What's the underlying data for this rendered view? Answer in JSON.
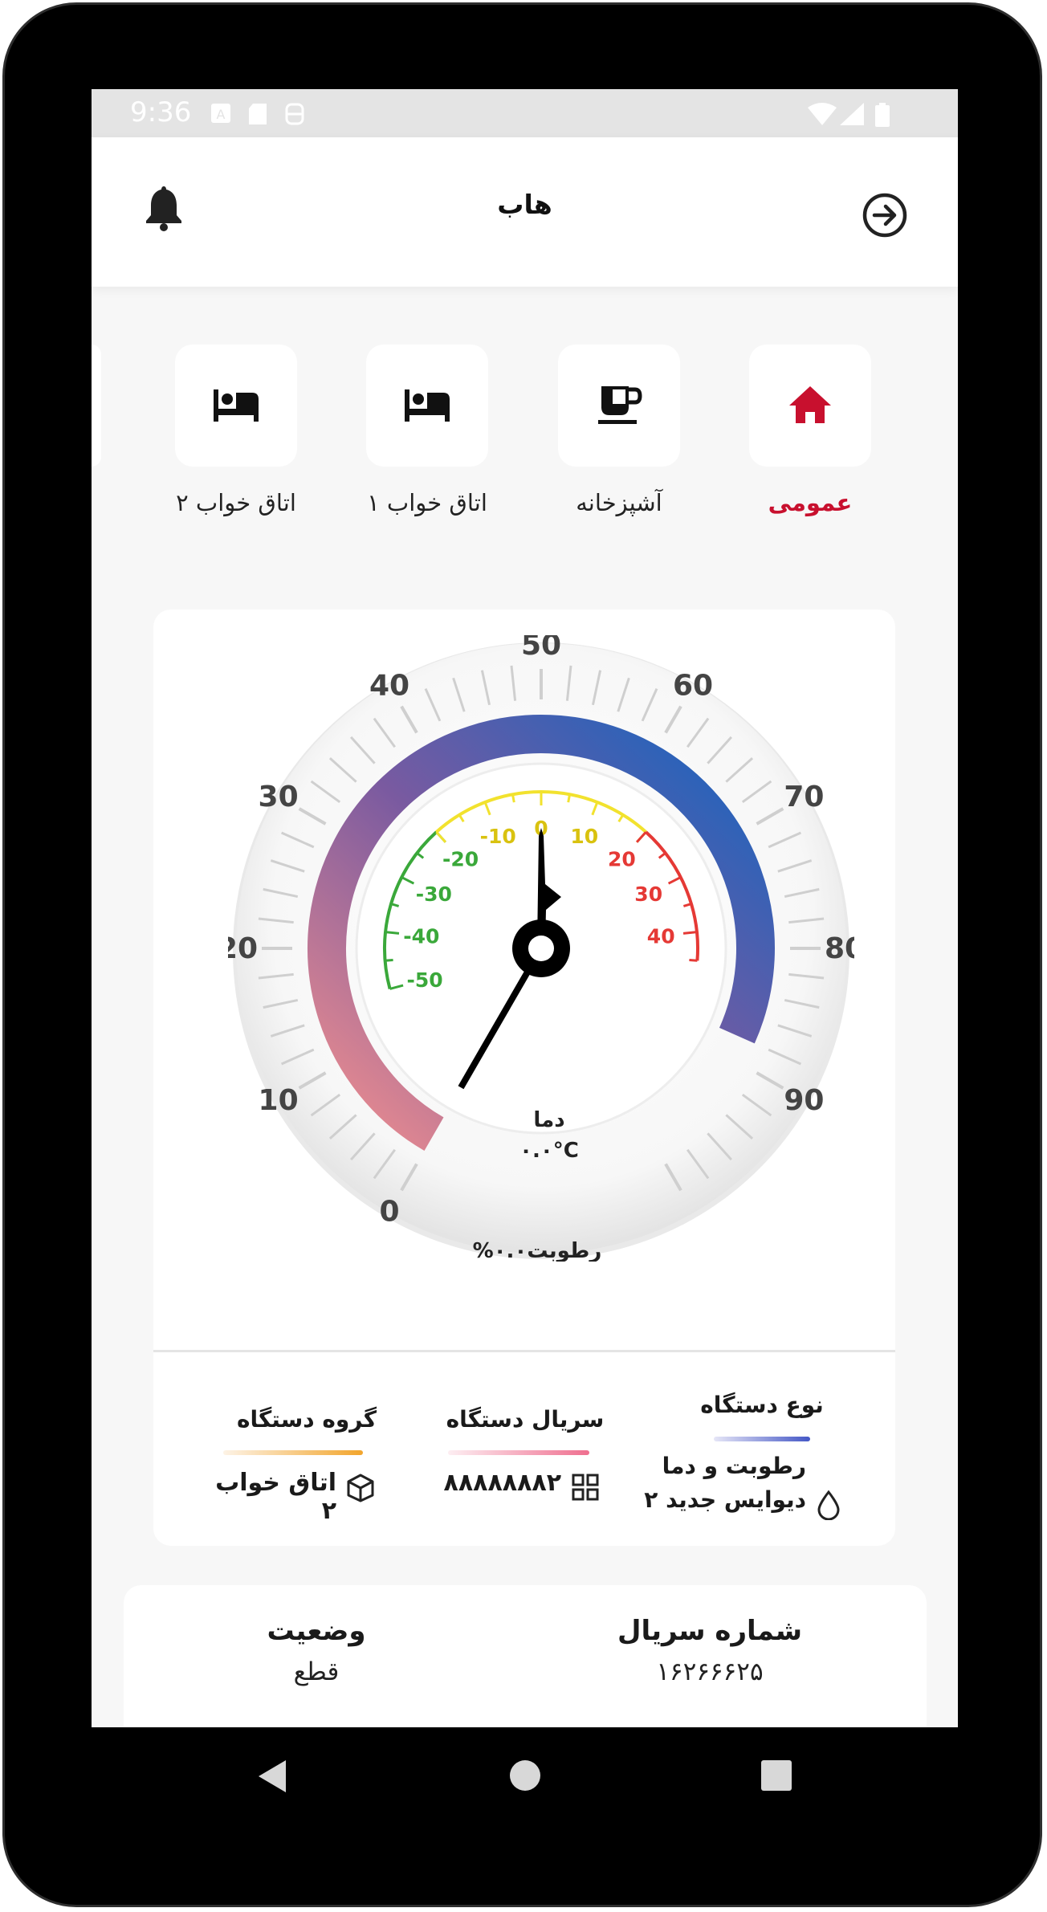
{
  "status_bar": {
    "time": "9:36"
  },
  "header": {
    "title": "هاب",
    "bell_icon": "bell-icon",
    "nav_icon": "arrow-right-circle-icon"
  },
  "categories": [
    {
      "label": "عمومی",
      "icon": "home-icon",
      "active": true
    },
    {
      "label": "آشپزخانه",
      "icon": "cup-icon",
      "active": false
    },
    {
      "label": "اتاق خواب ۱",
      "icon": "bed-icon",
      "active": false
    },
    {
      "label": "اتاق خواب ۲",
      "icon": "bed-icon",
      "active": false
    }
  ],
  "gauge": {
    "outer_ticks": [
      "0",
      "10",
      "20",
      "30",
      "40",
      "50",
      "60",
      "70",
      "80",
      "90"
    ],
    "inner_ticks": [
      "-50",
      "-40",
      "-30",
      "-20",
      "-10",
      "0",
      "10",
      "20",
      "30",
      "40"
    ],
    "temp_label": "دما",
    "temp_value": "۰.۰°C",
    "humidity_label": "%۰.۰رطوبت",
    "colors": {
      "humidity_low": "#f08e8e",
      "humidity_mid": "#7a5aa0",
      "humidity_high": "#1565c0",
      "temp_cold": "#3aa83a",
      "temp_mid": "#f2e22e",
      "temp_hot": "#e53935"
    }
  },
  "device_info": {
    "type": {
      "title": "نوع دستگاه",
      "line1": "رطوبت و دما",
      "line2": "دیوایس جدید ۲",
      "icon": "drop-icon"
    },
    "serial": {
      "title": "سریال دستگاه",
      "value": "۸۸۸۸۸۸۸۲",
      "icon": "grid-icon"
    },
    "group": {
      "title": "گروه دستگاه",
      "value": "اتاق خواب ۲",
      "icon": "cube-icon"
    }
  },
  "details": {
    "serial_number": {
      "title": "شماره سریال",
      "value": "۱۶۲۶۶۶۲۵"
    },
    "status": {
      "title": "وضعیت",
      "value": "قطع"
    }
  }
}
